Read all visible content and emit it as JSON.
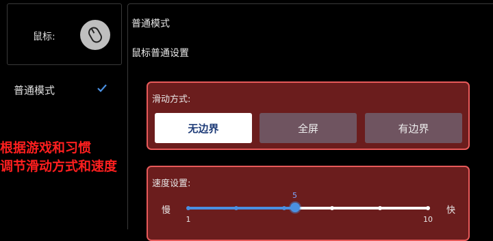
{
  "sidebar": {
    "mouse_label": "鼠标:",
    "mode_label": "普通模式"
  },
  "annotation": "根据游戏和习惯\n调节滑动方式和速度",
  "panel": {
    "title": "普通模式",
    "subtitle": "鼠标普通设置"
  },
  "scroll_mode": {
    "label": "滑动方式:",
    "options": [
      "无边界",
      "全屏",
      "有边界"
    ],
    "selected": "无边界"
  },
  "speed": {
    "label": "速度设置:",
    "low_label": "慢",
    "high_label": "快",
    "value": 5,
    "min_label": "1",
    "max_label": "10"
  },
  "colors": {
    "accent": "#4a90e2",
    "section_bg": "#6b1d1d",
    "section_border": "#e85a5a",
    "annotation": "#ff1f1f"
  }
}
